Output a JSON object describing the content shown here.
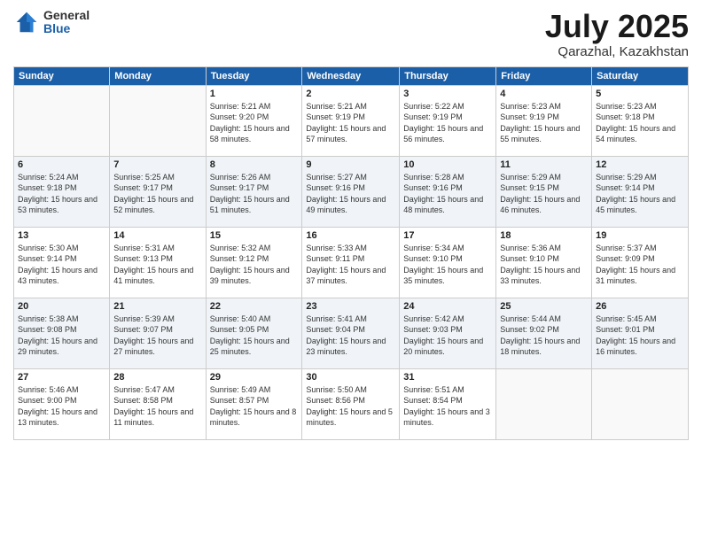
{
  "logo": {
    "general": "General",
    "blue": "Blue"
  },
  "title": {
    "month_year": "July 2025",
    "location": "Qarazhal, Kazakhstan"
  },
  "weekdays": [
    "Sunday",
    "Monday",
    "Tuesday",
    "Wednesday",
    "Thursday",
    "Friday",
    "Saturday"
  ],
  "weeks": [
    [
      {
        "day": "",
        "sunrise": "",
        "sunset": "",
        "daylight": ""
      },
      {
        "day": "",
        "sunrise": "",
        "sunset": "",
        "daylight": ""
      },
      {
        "day": "1",
        "sunrise": "Sunrise: 5:21 AM",
        "sunset": "Sunset: 9:20 PM",
        "daylight": "Daylight: 15 hours and 58 minutes."
      },
      {
        "day": "2",
        "sunrise": "Sunrise: 5:21 AM",
        "sunset": "Sunset: 9:19 PM",
        "daylight": "Daylight: 15 hours and 57 minutes."
      },
      {
        "day": "3",
        "sunrise": "Sunrise: 5:22 AM",
        "sunset": "Sunset: 9:19 PM",
        "daylight": "Daylight: 15 hours and 56 minutes."
      },
      {
        "day": "4",
        "sunrise": "Sunrise: 5:23 AM",
        "sunset": "Sunset: 9:19 PM",
        "daylight": "Daylight: 15 hours and 55 minutes."
      },
      {
        "day": "5",
        "sunrise": "Sunrise: 5:23 AM",
        "sunset": "Sunset: 9:18 PM",
        "daylight": "Daylight: 15 hours and 54 minutes."
      }
    ],
    [
      {
        "day": "6",
        "sunrise": "Sunrise: 5:24 AM",
        "sunset": "Sunset: 9:18 PM",
        "daylight": "Daylight: 15 hours and 53 minutes."
      },
      {
        "day": "7",
        "sunrise": "Sunrise: 5:25 AM",
        "sunset": "Sunset: 9:17 PM",
        "daylight": "Daylight: 15 hours and 52 minutes."
      },
      {
        "day": "8",
        "sunrise": "Sunrise: 5:26 AM",
        "sunset": "Sunset: 9:17 PM",
        "daylight": "Daylight: 15 hours and 51 minutes."
      },
      {
        "day": "9",
        "sunrise": "Sunrise: 5:27 AM",
        "sunset": "Sunset: 9:16 PM",
        "daylight": "Daylight: 15 hours and 49 minutes."
      },
      {
        "day": "10",
        "sunrise": "Sunrise: 5:28 AM",
        "sunset": "Sunset: 9:16 PM",
        "daylight": "Daylight: 15 hours and 48 minutes."
      },
      {
        "day": "11",
        "sunrise": "Sunrise: 5:29 AM",
        "sunset": "Sunset: 9:15 PM",
        "daylight": "Daylight: 15 hours and 46 minutes."
      },
      {
        "day": "12",
        "sunrise": "Sunrise: 5:29 AM",
        "sunset": "Sunset: 9:14 PM",
        "daylight": "Daylight: 15 hours and 45 minutes."
      }
    ],
    [
      {
        "day": "13",
        "sunrise": "Sunrise: 5:30 AM",
        "sunset": "Sunset: 9:14 PM",
        "daylight": "Daylight: 15 hours and 43 minutes."
      },
      {
        "day": "14",
        "sunrise": "Sunrise: 5:31 AM",
        "sunset": "Sunset: 9:13 PM",
        "daylight": "Daylight: 15 hours and 41 minutes."
      },
      {
        "day": "15",
        "sunrise": "Sunrise: 5:32 AM",
        "sunset": "Sunset: 9:12 PM",
        "daylight": "Daylight: 15 hours and 39 minutes."
      },
      {
        "day": "16",
        "sunrise": "Sunrise: 5:33 AM",
        "sunset": "Sunset: 9:11 PM",
        "daylight": "Daylight: 15 hours and 37 minutes."
      },
      {
        "day": "17",
        "sunrise": "Sunrise: 5:34 AM",
        "sunset": "Sunset: 9:10 PM",
        "daylight": "Daylight: 15 hours and 35 minutes."
      },
      {
        "day": "18",
        "sunrise": "Sunrise: 5:36 AM",
        "sunset": "Sunset: 9:10 PM",
        "daylight": "Daylight: 15 hours and 33 minutes."
      },
      {
        "day": "19",
        "sunrise": "Sunrise: 5:37 AM",
        "sunset": "Sunset: 9:09 PM",
        "daylight": "Daylight: 15 hours and 31 minutes."
      }
    ],
    [
      {
        "day": "20",
        "sunrise": "Sunrise: 5:38 AM",
        "sunset": "Sunset: 9:08 PM",
        "daylight": "Daylight: 15 hours and 29 minutes."
      },
      {
        "day": "21",
        "sunrise": "Sunrise: 5:39 AM",
        "sunset": "Sunset: 9:07 PM",
        "daylight": "Daylight: 15 hours and 27 minutes."
      },
      {
        "day": "22",
        "sunrise": "Sunrise: 5:40 AM",
        "sunset": "Sunset: 9:05 PM",
        "daylight": "Daylight: 15 hours and 25 minutes."
      },
      {
        "day": "23",
        "sunrise": "Sunrise: 5:41 AM",
        "sunset": "Sunset: 9:04 PM",
        "daylight": "Daylight: 15 hours and 23 minutes."
      },
      {
        "day": "24",
        "sunrise": "Sunrise: 5:42 AM",
        "sunset": "Sunset: 9:03 PM",
        "daylight": "Daylight: 15 hours and 20 minutes."
      },
      {
        "day": "25",
        "sunrise": "Sunrise: 5:44 AM",
        "sunset": "Sunset: 9:02 PM",
        "daylight": "Daylight: 15 hours and 18 minutes."
      },
      {
        "day": "26",
        "sunrise": "Sunrise: 5:45 AM",
        "sunset": "Sunset: 9:01 PM",
        "daylight": "Daylight: 15 hours and 16 minutes."
      }
    ],
    [
      {
        "day": "27",
        "sunrise": "Sunrise: 5:46 AM",
        "sunset": "Sunset: 9:00 PM",
        "daylight": "Daylight: 15 hours and 13 minutes."
      },
      {
        "day": "28",
        "sunrise": "Sunrise: 5:47 AM",
        "sunset": "Sunset: 8:58 PM",
        "daylight": "Daylight: 15 hours and 11 minutes."
      },
      {
        "day": "29",
        "sunrise": "Sunrise: 5:49 AM",
        "sunset": "Sunset: 8:57 PM",
        "daylight": "Daylight: 15 hours and 8 minutes."
      },
      {
        "day": "30",
        "sunrise": "Sunrise: 5:50 AM",
        "sunset": "Sunset: 8:56 PM",
        "daylight": "Daylight: 15 hours and 5 minutes."
      },
      {
        "day": "31",
        "sunrise": "Sunrise: 5:51 AM",
        "sunset": "Sunset: 8:54 PM",
        "daylight": "Daylight: 15 hours and 3 minutes."
      },
      {
        "day": "",
        "sunrise": "",
        "sunset": "",
        "daylight": ""
      },
      {
        "day": "",
        "sunrise": "",
        "sunset": "",
        "daylight": ""
      }
    ]
  ]
}
